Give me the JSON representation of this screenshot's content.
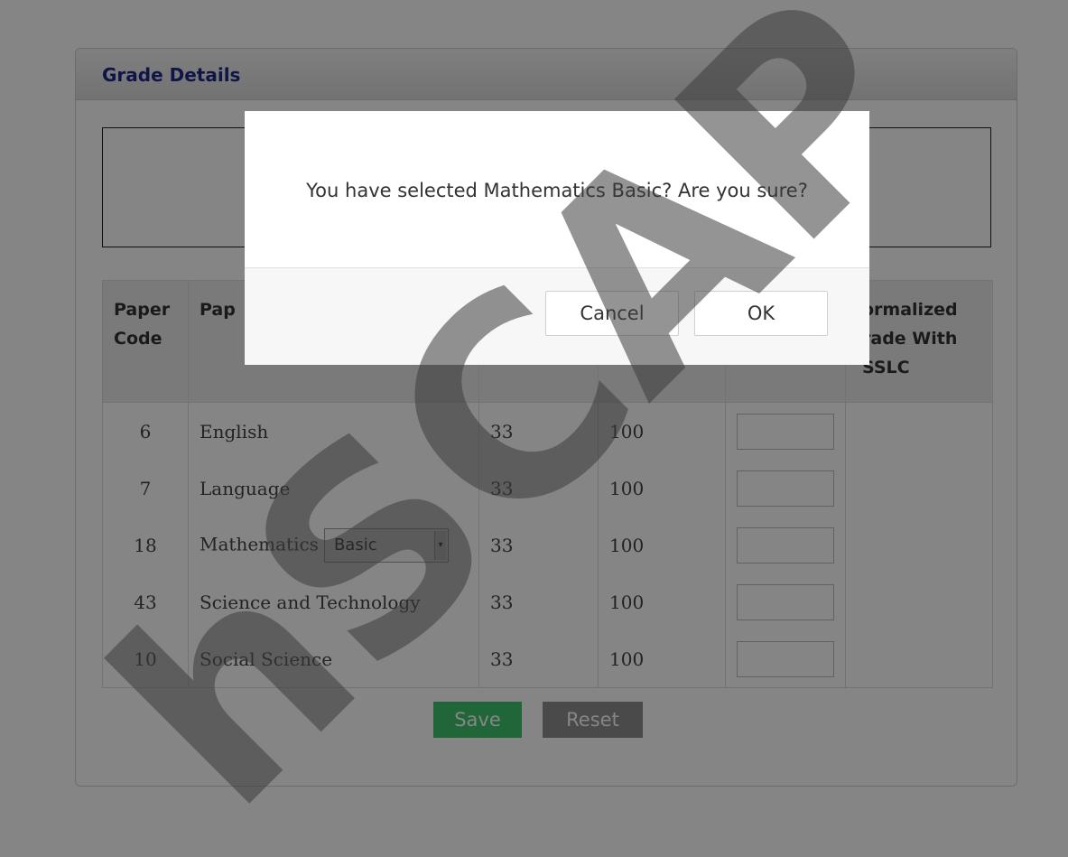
{
  "panel": {
    "title": "Grade Details"
  },
  "table": {
    "headers": {
      "paper_code": "Paper Code",
      "paper": "Pap",
      "normalized": "ormalized rade With SSLC"
    },
    "rows": [
      {
        "code": "6",
        "name": "English",
        "min": "33",
        "max": "100"
      },
      {
        "code": "7",
        "name": "Language",
        "min": "33",
        "max": "100"
      },
      {
        "code": "18",
        "name": "Mathematics",
        "min": "33",
        "max": "100",
        "select_value": "Basic"
      },
      {
        "code": "43",
        "name": "Science and Technology",
        "min": "33",
        "max": "100"
      },
      {
        "code": "10",
        "name": "Social Science",
        "min": "33",
        "max": "100"
      }
    ]
  },
  "actions": {
    "save_label": "Save",
    "reset_label": "Reset"
  },
  "dialog": {
    "message": "You have selected Mathematics Basic? Are you sure?",
    "cancel_label": "Cancel",
    "ok_label": "OK"
  },
  "watermark": {
    "text": "hSCAP"
  },
  "colors": {
    "save": "#3ec46d",
    "reset": "#8f8f8f",
    "title": "#1f2a8a"
  }
}
